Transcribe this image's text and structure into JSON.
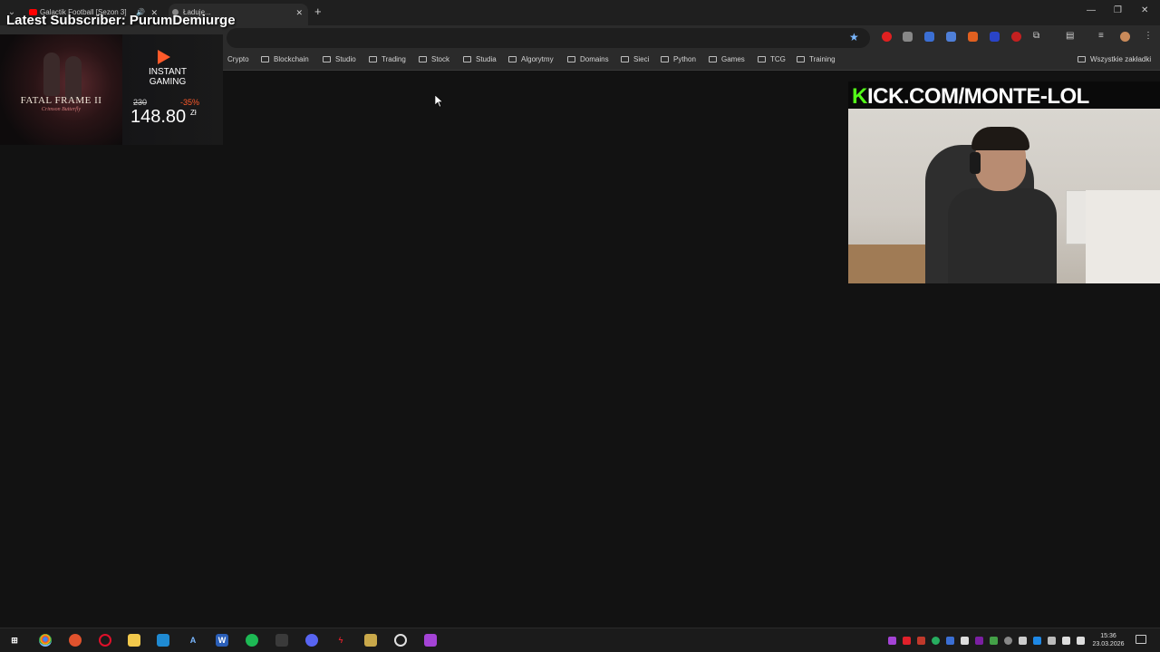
{
  "browser": {
    "tabs": [
      {
        "title": "Galactik Football [Sezon 3]",
        "favicon_color": "#ff0000"
      },
      {
        "title": "Ładuję..."
      }
    ],
    "new_tab_label": "+",
    "bookmarks": [
      "Crypto",
      "Blockchain",
      "Studio",
      "Trading",
      "Stock",
      "Studia",
      "Algorytmy",
      "Domains",
      "Sieci",
      "Python",
      "Games",
      "TCG",
      "Training"
    ],
    "all_bookmarks_label": "Wszystkie zakładki"
  },
  "overlay": {
    "subscriber_banner": "Latest Subscriber: PurumDemiurge",
    "ad": {
      "game_title": "FATAL FRAME II",
      "game_subtitle": "Crimson Butterfly",
      "brand_line1": "INSTANT",
      "brand_line2": "GAMING",
      "old_price": "230",
      "discount": "-35%",
      "price": "148.80",
      "currency": "Zł"
    },
    "kick_banner": {
      "k": "K",
      "rest": "ICK.COM/MONTE-LOL"
    }
  },
  "taskbar": {
    "time": "15:36",
    "date": "23.03.2026",
    "apps": [
      "windows-start",
      "chrome",
      "brave",
      "opera",
      "file-explorer",
      "vscode",
      "arc",
      "word",
      "spotify",
      "calculator",
      "discord",
      "flash",
      "package",
      "obs",
      "capture"
    ]
  },
  "colors": {
    "kick_green": "#53fc18",
    "ad_accent": "#ff5a2a",
    "star_blue": "#7ab7ff"
  }
}
